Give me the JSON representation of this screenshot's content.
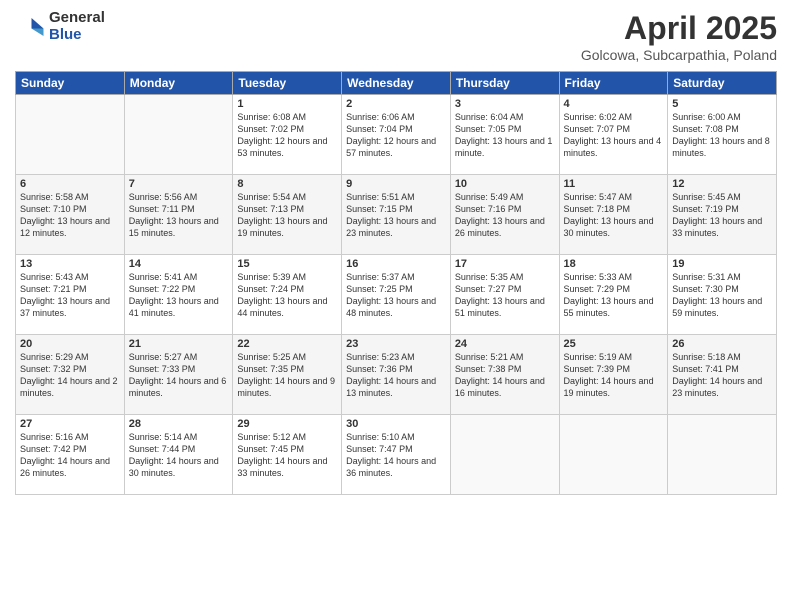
{
  "header": {
    "logo_general": "General",
    "logo_blue": "Blue",
    "month_title": "April 2025",
    "subtitle": "Golcowa, Subcarpathia, Poland"
  },
  "days_of_week": [
    "Sunday",
    "Monday",
    "Tuesday",
    "Wednesday",
    "Thursday",
    "Friday",
    "Saturday"
  ],
  "weeks": [
    [
      {
        "day": "",
        "sunrise": "",
        "sunset": "",
        "daylight": ""
      },
      {
        "day": "",
        "sunrise": "",
        "sunset": "",
        "daylight": ""
      },
      {
        "day": "1",
        "sunrise": "Sunrise: 6:08 AM",
        "sunset": "Sunset: 7:02 PM",
        "daylight": "Daylight: 12 hours and 53 minutes."
      },
      {
        "day": "2",
        "sunrise": "Sunrise: 6:06 AM",
        "sunset": "Sunset: 7:04 PM",
        "daylight": "Daylight: 12 hours and 57 minutes."
      },
      {
        "day": "3",
        "sunrise": "Sunrise: 6:04 AM",
        "sunset": "Sunset: 7:05 PM",
        "daylight": "Daylight: 13 hours and 1 minute."
      },
      {
        "day": "4",
        "sunrise": "Sunrise: 6:02 AM",
        "sunset": "Sunset: 7:07 PM",
        "daylight": "Daylight: 13 hours and 4 minutes."
      },
      {
        "day": "5",
        "sunrise": "Sunrise: 6:00 AM",
        "sunset": "Sunset: 7:08 PM",
        "daylight": "Daylight: 13 hours and 8 minutes."
      }
    ],
    [
      {
        "day": "6",
        "sunrise": "Sunrise: 5:58 AM",
        "sunset": "Sunset: 7:10 PM",
        "daylight": "Daylight: 13 hours and 12 minutes."
      },
      {
        "day": "7",
        "sunrise": "Sunrise: 5:56 AM",
        "sunset": "Sunset: 7:11 PM",
        "daylight": "Daylight: 13 hours and 15 minutes."
      },
      {
        "day": "8",
        "sunrise": "Sunrise: 5:54 AM",
        "sunset": "Sunset: 7:13 PM",
        "daylight": "Daylight: 13 hours and 19 minutes."
      },
      {
        "day": "9",
        "sunrise": "Sunrise: 5:51 AM",
        "sunset": "Sunset: 7:15 PM",
        "daylight": "Daylight: 13 hours and 23 minutes."
      },
      {
        "day": "10",
        "sunrise": "Sunrise: 5:49 AM",
        "sunset": "Sunset: 7:16 PM",
        "daylight": "Daylight: 13 hours and 26 minutes."
      },
      {
        "day": "11",
        "sunrise": "Sunrise: 5:47 AM",
        "sunset": "Sunset: 7:18 PM",
        "daylight": "Daylight: 13 hours and 30 minutes."
      },
      {
        "day": "12",
        "sunrise": "Sunrise: 5:45 AM",
        "sunset": "Sunset: 7:19 PM",
        "daylight": "Daylight: 13 hours and 33 minutes."
      }
    ],
    [
      {
        "day": "13",
        "sunrise": "Sunrise: 5:43 AM",
        "sunset": "Sunset: 7:21 PM",
        "daylight": "Daylight: 13 hours and 37 minutes."
      },
      {
        "day": "14",
        "sunrise": "Sunrise: 5:41 AM",
        "sunset": "Sunset: 7:22 PM",
        "daylight": "Daylight: 13 hours and 41 minutes."
      },
      {
        "day": "15",
        "sunrise": "Sunrise: 5:39 AM",
        "sunset": "Sunset: 7:24 PM",
        "daylight": "Daylight: 13 hours and 44 minutes."
      },
      {
        "day": "16",
        "sunrise": "Sunrise: 5:37 AM",
        "sunset": "Sunset: 7:25 PM",
        "daylight": "Daylight: 13 hours and 48 minutes."
      },
      {
        "day": "17",
        "sunrise": "Sunrise: 5:35 AM",
        "sunset": "Sunset: 7:27 PM",
        "daylight": "Daylight: 13 hours and 51 minutes."
      },
      {
        "day": "18",
        "sunrise": "Sunrise: 5:33 AM",
        "sunset": "Sunset: 7:29 PM",
        "daylight": "Daylight: 13 hours and 55 minutes."
      },
      {
        "day": "19",
        "sunrise": "Sunrise: 5:31 AM",
        "sunset": "Sunset: 7:30 PM",
        "daylight": "Daylight: 13 hours and 59 minutes."
      }
    ],
    [
      {
        "day": "20",
        "sunrise": "Sunrise: 5:29 AM",
        "sunset": "Sunset: 7:32 PM",
        "daylight": "Daylight: 14 hours and 2 minutes."
      },
      {
        "day": "21",
        "sunrise": "Sunrise: 5:27 AM",
        "sunset": "Sunset: 7:33 PM",
        "daylight": "Daylight: 14 hours and 6 minutes."
      },
      {
        "day": "22",
        "sunrise": "Sunrise: 5:25 AM",
        "sunset": "Sunset: 7:35 PM",
        "daylight": "Daylight: 14 hours and 9 minutes."
      },
      {
        "day": "23",
        "sunrise": "Sunrise: 5:23 AM",
        "sunset": "Sunset: 7:36 PM",
        "daylight": "Daylight: 14 hours and 13 minutes."
      },
      {
        "day": "24",
        "sunrise": "Sunrise: 5:21 AM",
        "sunset": "Sunset: 7:38 PM",
        "daylight": "Daylight: 14 hours and 16 minutes."
      },
      {
        "day": "25",
        "sunrise": "Sunrise: 5:19 AM",
        "sunset": "Sunset: 7:39 PM",
        "daylight": "Daylight: 14 hours and 19 minutes."
      },
      {
        "day": "26",
        "sunrise": "Sunrise: 5:18 AM",
        "sunset": "Sunset: 7:41 PM",
        "daylight": "Daylight: 14 hours and 23 minutes."
      }
    ],
    [
      {
        "day": "27",
        "sunrise": "Sunrise: 5:16 AM",
        "sunset": "Sunset: 7:42 PM",
        "daylight": "Daylight: 14 hours and 26 minutes."
      },
      {
        "day": "28",
        "sunrise": "Sunrise: 5:14 AM",
        "sunset": "Sunset: 7:44 PM",
        "daylight": "Daylight: 14 hours and 30 minutes."
      },
      {
        "day": "29",
        "sunrise": "Sunrise: 5:12 AM",
        "sunset": "Sunset: 7:45 PM",
        "daylight": "Daylight: 14 hours and 33 minutes."
      },
      {
        "day": "30",
        "sunrise": "Sunrise: 5:10 AM",
        "sunset": "Sunset: 7:47 PM",
        "daylight": "Daylight: 14 hours and 36 minutes."
      },
      {
        "day": "",
        "sunrise": "",
        "sunset": "",
        "daylight": ""
      },
      {
        "day": "",
        "sunrise": "",
        "sunset": "",
        "daylight": ""
      },
      {
        "day": "",
        "sunrise": "",
        "sunset": "",
        "daylight": ""
      }
    ]
  ]
}
